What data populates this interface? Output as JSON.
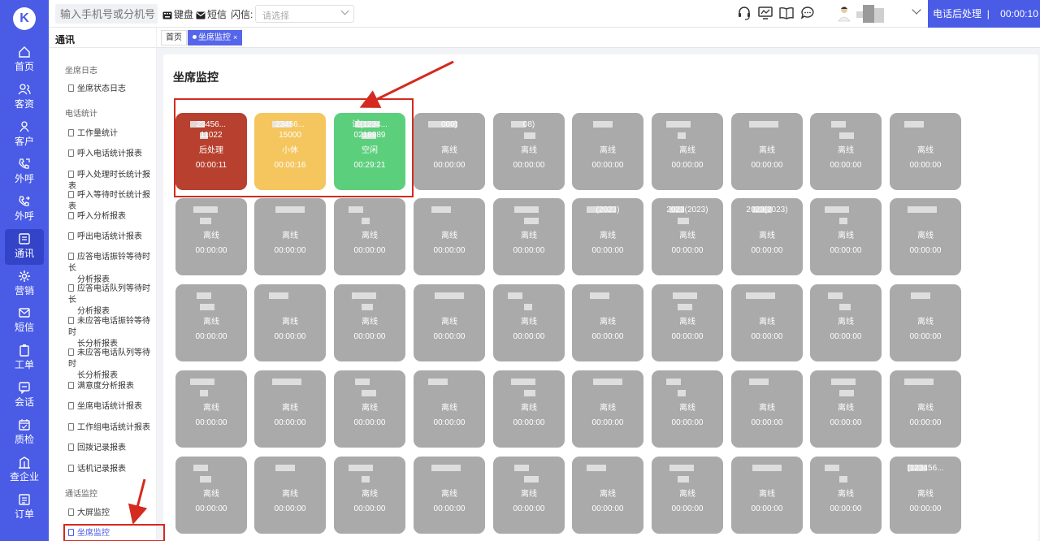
{
  "topbar": {
    "phone_placeholder": "输入手机号或分机号",
    "keyboard_label": "键盘",
    "sms_label": "短信",
    "flash_label": "闪信:",
    "flash_select_placeholder": "请选择",
    "call_status_label": "电话后处理",
    "call_status_time": "00:00:10"
  },
  "rail": {
    "items": [
      {
        "label": "首页",
        "icon": "home-icon"
      },
      {
        "label": "客资",
        "icon": "users-icon"
      },
      {
        "label": "客户",
        "icon": "person-icon"
      },
      {
        "label": "外呼",
        "icon": "phone-out-icon"
      },
      {
        "label": "外呼",
        "icon": "phone-forward-icon"
      },
      {
        "label": "通讯",
        "icon": "contacts-icon"
      },
      {
        "label": "营销",
        "icon": "gear-icon"
      },
      {
        "label": "短信",
        "icon": "message-icon"
      },
      {
        "label": "工单",
        "icon": "clipboard-icon"
      },
      {
        "label": "会话",
        "icon": "chat-icon"
      },
      {
        "label": "质检",
        "icon": "calendar-check-icon"
      },
      {
        "label": "查企业",
        "icon": "building-icon"
      },
      {
        "label": "订单",
        "icon": "order-icon"
      }
    ]
  },
  "subnav": {
    "title": "通讯",
    "groups": {
      "agent_log": "坐席日志",
      "phone_stats": "电话统计",
      "call_monitor": "通话监控"
    },
    "items": {
      "agent_status_log": "坐席状态日志",
      "workload": "工作量统计",
      "inbound_stats": "呼入电话统计报表",
      "inbound_handle_time": "呼入处理时长统计报表",
      "inbound_wait_time": "呼入等待时长统计报表",
      "inbound_analysis": "呼入分析报表",
      "outbound_stats": "呼出电话统计报表",
      "answered_ring_l1": "应答电话振铃等待时长",
      "answered_ring_l2": "分析报表",
      "answered_queue_l1": "应答电话队列等待时长",
      "answered_queue_l2": "分析报表",
      "unanswered_ring_l1": "未应答电话振铃等待时",
      "unanswered_ring_l2": "长分析报表",
      "unanswered_queue_l1": "未应答电话队列等待时",
      "unanswered_queue_l2": "长分析报表",
      "satisfaction": "满意度分析报表",
      "agent_calls": "坐席电话统计报表",
      "group_calls": "工作组电话统计报表",
      "callback": "回拨记录报表",
      "phone_records": "话机记录报表",
      "big_screen": "大屏监控",
      "agent_monitor": "坐席监控"
    }
  },
  "tabs": {
    "home": "首页",
    "agent_monitor": "坐席监控",
    "close": "×"
  },
  "panel": {
    "title": "坐席监控"
  },
  "cards": [
    {
      "name": "23456...",
      "sub": "11022",
      "status": "后处理",
      "time": "00:00:11",
      "color": "red"
    },
    {
      "name": "23456...",
      "sub": "15000",
      "status": "小休",
      "time": "00:00:16",
      "color": "yellow"
    },
    {
      "name": "试(1234...",
      "sub": "0218989",
      "status": "空闲",
      "time": "00:29:21",
      "color": "green"
    },
    {
      "name": "000)",
      "sub": "",
      "status": "离线",
      "time": "00:00:00",
      "color": "gray"
    },
    {
      "name": "08)",
      "sub": "",
      "status": "离线",
      "time": "00:00:00",
      "color": "gray"
    },
    {
      "name": "",
      "sub": "",
      "status": "离线",
      "time": "00:00:00",
      "color": "gray"
    },
    {
      "name": "",
      "sub": "",
      "status": "离线",
      "time": "00:00:00",
      "color": "gray"
    },
    {
      "name": "",
      "sub": "",
      "status": "离线",
      "time": "00:00:00",
      "color": "gray"
    },
    {
      "name": "",
      "sub": "",
      "status": "离线",
      "time": "00:00:00",
      "color": "gray"
    },
    {
      "name": "",
      "sub": "",
      "status": "离线",
      "time": "00:00:00",
      "color": "gray"
    },
    {
      "name": "",
      "sub": "",
      "status": "离线",
      "time": "00:00:00",
      "color": "gray"
    },
    {
      "name": "",
      "sub": "",
      "status": "离线",
      "time": "00:00:00",
      "color": "gray"
    },
    {
      "name": "",
      "sub": "",
      "status": "离线",
      "time": "00:00:00",
      "color": "gray"
    },
    {
      "name": "",
      "sub": "",
      "status": "离线",
      "time": "00:00:00",
      "color": "gray"
    },
    {
      "name": "",
      "sub": "",
      "status": "离线",
      "time": "00:00:00",
      "color": "gray"
    },
    {
      "name": "(2023)",
      "sub": "",
      "status": "离线",
      "time": "00:00:00",
      "color": "gray"
    },
    {
      "name": "2023(2023)",
      "sub": "",
      "status": "离线",
      "time": "00:00:00",
      "color": "gray"
    },
    {
      "name": "2023(2023)",
      "sub": "",
      "status": "离线",
      "time": "00:00:00",
      "color": "gray"
    },
    {
      "name": "",
      "sub": "",
      "status": "离线",
      "time": "00:00:00",
      "color": "gray"
    },
    {
      "name": "",
      "sub": "",
      "status": "离线",
      "time": "00:00:00",
      "color": "gray"
    },
    {
      "name": "",
      "sub": "",
      "status": "离线",
      "time": "00:00:00",
      "color": "gray"
    },
    {
      "name": "",
      "sub": "",
      "status": "离线",
      "time": "00:00:00",
      "color": "gray"
    },
    {
      "name": "",
      "sub": "",
      "status": "离线",
      "time": "00:00:00",
      "color": "gray"
    },
    {
      "name": "",
      "sub": "",
      "status": "离线",
      "time": "00:00:00",
      "color": "gray"
    },
    {
      "name": "",
      "sub": "",
      "status": "离线",
      "time": "00:00:00",
      "color": "gray"
    },
    {
      "name": "",
      "sub": "",
      "status": "离线",
      "time": "00:00:00",
      "color": "gray"
    },
    {
      "name": "",
      "sub": "",
      "status": "离线",
      "time": "00:00:00",
      "color": "gray"
    },
    {
      "name": "",
      "sub": "",
      "status": "离线",
      "time": "00:00:00",
      "color": "gray"
    },
    {
      "name": "",
      "sub": "",
      "status": "离线",
      "time": "00:00:00",
      "color": "gray"
    },
    {
      "name": "",
      "sub": "",
      "status": "离线",
      "time": "00:00:00",
      "color": "gray"
    },
    {
      "name": "",
      "sub": "",
      "status": "离线",
      "time": "00:00:00",
      "color": "gray"
    },
    {
      "name": "",
      "sub": "",
      "status": "离线",
      "time": "00:00:00",
      "color": "gray"
    },
    {
      "name": "",
      "sub": "",
      "status": "离线",
      "time": "00:00:00",
      "color": "gray"
    },
    {
      "name": "",
      "sub": "",
      "status": "离线",
      "time": "00:00:00",
      "color": "gray"
    },
    {
      "name": "",
      "sub": "",
      "status": "离线",
      "time": "00:00:00",
      "color": "gray"
    },
    {
      "name": "",
      "sub": "",
      "status": "离线",
      "time": "00:00:00",
      "color": "gray"
    },
    {
      "name": "",
      "sub": "",
      "status": "离线",
      "time": "00:00:00",
      "color": "gray"
    },
    {
      "name": "",
      "sub": "",
      "status": "离线",
      "time": "00:00:00",
      "color": "gray"
    },
    {
      "name": "",
      "sub": "",
      "status": "离线",
      "time": "00:00:00",
      "color": "gray"
    },
    {
      "name": "",
      "sub": "",
      "status": "离线",
      "time": "00:00:00",
      "color": "gray"
    },
    {
      "name": "",
      "sub": "",
      "status": "离线",
      "time": "00:00:00",
      "color": "gray"
    },
    {
      "name": "",
      "sub": "",
      "status": "离线",
      "time": "00:00:00",
      "color": "gray"
    },
    {
      "name": "",
      "sub": "",
      "status": "离线",
      "time": "00:00:00",
      "color": "gray"
    },
    {
      "name": "",
      "sub": "",
      "status": "离线",
      "time": "00:00:00",
      "color": "gray"
    },
    {
      "name": "",
      "sub": "",
      "status": "离线",
      "time": "00:00:00",
      "color": "gray"
    },
    {
      "name": "",
      "sub": "",
      "status": "离线",
      "time": "00:00:00",
      "color": "gray"
    },
    {
      "name": "",
      "sub": "",
      "status": "离线",
      "time": "00:00:00",
      "color": "gray"
    },
    {
      "name": "",
      "sub": "",
      "status": "离线",
      "time": "00:00:00",
      "color": "gray"
    },
    {
      "name": "",
      "sub": "",
      "status": "离线",
      "time": "00:00:00",
      "color": "gray"
    },
    {
      "name": "(123456...",
      "sub": "",
      "status": "离线",
      "time": "00:00:00",
      "color": "gray"
    },
    {
      "name": "",
      "sub": "",
      "status": "离线",
      "time": "00:00:00",
      "color": "gray"
    }
  ],
  "colors": {
    "brand": "#4a5be6",
    "card_offline": "#aaaaaa",
    "card_after_call": "#b8402f",
    "card_break": "#f5c55e",
    "card_idle": "#5ccf7c",
    "annotation": "#d42a20"
  }
}
